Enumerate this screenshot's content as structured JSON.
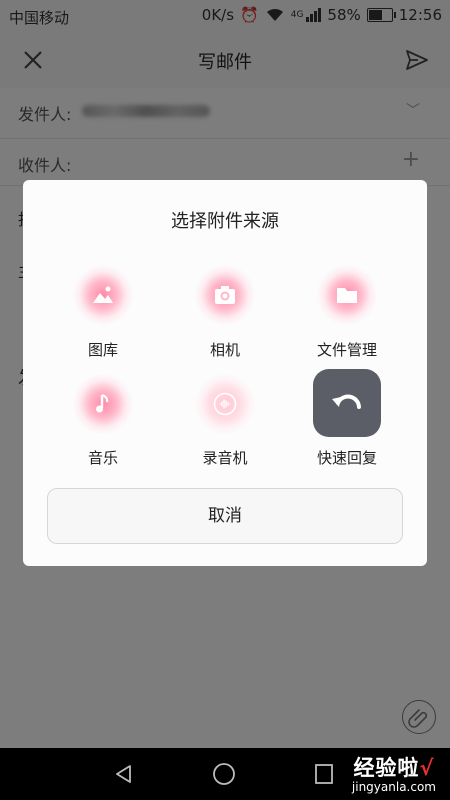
{
  "status_bar": {
    "carrier": "中国移动",
    "speed": "0K/s",
    "network": "4G",
    "battery": "58%",
    "battery_level": 0.58,
    "time": "12:56"
  },
  "header": {
    "title": "写邮件"
  },
  "compose": {
    "sender_label": "发件人:",
    "recipient_label": "收件人:",
    "cc_stub": "抄",
    "subject_stub": "主",
    "body_stub": "发"
  },
  "dialog": {
    "title": "选择附件来源",
    "options": [
      {
        "label": "图库",
        "icon": "gallery-icon"
      },
      {
        "label": "相机",
        "icon": "camera-icon"
      },
      {
        "label": "文件管理",
        "icon": "folder-icon"
      },
      {
        "label": "音乐",
        "icon": "music-note-icon"
      },
      {
        "label": "录音机",
        "icon": "recorder-icon"
      },
      {
        "label": "快速回复",
        "icon": "undo-arrow-icon"
      }
    ],
    "cancel_label": "取消"
  },
  "watermark": {
    "title": "经验啦",
    "url": "jingyanla.com"
  },
  "colors": {
    "accent_glow": "#ff8aa8",
    "quick_reply_bg": "#5b5e66",
    "overlay": "#000000"
  }
}
